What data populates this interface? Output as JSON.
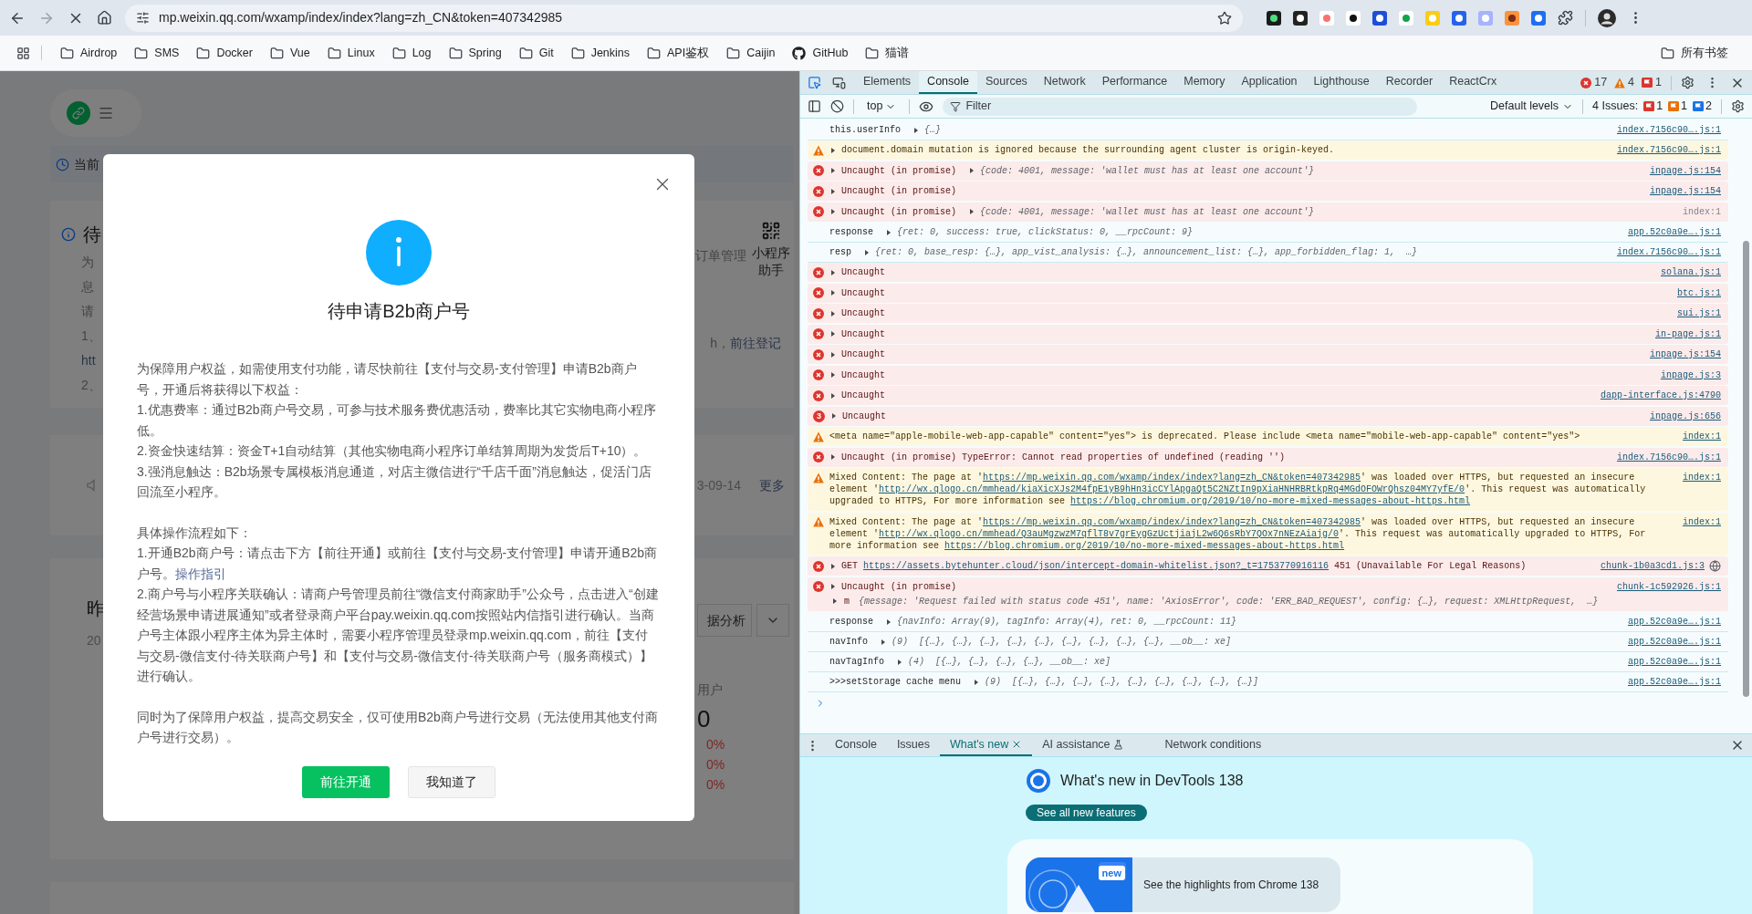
{
  "browser": {
    "url": "mp.weixin.qq.com/wxamp/index/index?lang=zh_CN&token=407342985",
    "bookmarks": [
      {
        "kind": "folder",
        "label": "Airdrop"
      },
      {
        "kind": "folder",
        "label": "SMS"
      },
      {
        "kind": "folder",
        "label": "Docker"
      },
      {
        "kind": "folder",
        "label": "Vue"
      },
      {
        "kind": "folder",
        "label": "Linux"
      },
      {
        "kind": "folder",
        "label": "Log"
      },
      {
        "kind": "folder",
        "label": "Spring"
      },
      {
        "kind": "folder",
        "label": "Git"
      },
      {
        "kind": "folder",
        "label": "Jenkins"
      },
      {
        "kind": "folder",
        "label": "API鉴权"
      },
      {
        "kind": "folder",
        "label": "Caijin"
      },
      {
        "kind": "site",
        "label": "GitHub"
      },
      {
        "kind": "folder",
        "label": "猫谱"
      }
    ],
    "all_bookmarks": "所有书签"
  },
  "page": {
    "banner": "当前",
    "notice": {
      "title": "待",
      "lines": [
        {
          "kind": "text",
          "text": "为"
        },
        {
          "kind": "text",
          "text": "息"
        },
        {
          "kind": "text",
          "text": "请"
        },
        {
          "kind": "text",
          "text": "1、"
        },
        {
          "kind": "link",
          "text": "htt"
        },
        {
          "kind": "text",
          "text": "2、"
        }
      ],
      "right_text": "订单管理",
      "helper": "小程序助手",
      "register_prefix": "h，",
      "register_link": "前往登记"
    },
    "announcement": {
      "date": "3-09-14",
      "more": "更多"
    },
    "stats": {
      "title": "昨",
      "date": "20",
      "analysis": "据分析",
      "metric": "用户",
      "value": "0",
      "changes": [
        "0%",
        "0%",
        "0%"
      ]
    }
  },
  "dialog": {
    "title": "待申请B2b商户号",
    "sections": [
      {
        "lines": [
          {
            "text": "为保障用户权益，如需使用支付功能，请尽快前往【支付与交易-支付管理】申请B2b商户号，开通后将获得以下权益："
          },
          {
            "text": "1.优惠费率：通过B2b商户号交易，可参与技术服务费优惠活动，费率比其它实物电商小程序低。"
          },
          {
            "text": "2.资金快速结算：资金T+1自动结算（其他实物电商小程序订单结算周期为发货后T+10）。"
          },
          {
            "text": "3.强消息触达：B2b场景专属模板消息通道，对店主微信进行“千店千面”消息触达，促活门店回流至小程序。"
          }
        ]
      },
      {
        "lines": [
          {
            "text": "具体操作流程如下："
          },
          {
            "text": "1.开通B2b商户号：请点击下方【前往开通】或前往【支付与交易-支付管理】申请开通B2b商户号。",
            "link": "操作指引"
          },
          {
            "text": "2.商户号与小程序关联确认：请商户号管理员前往“微信支付商家助手”公众号，点击进入“创建经营场景申请进展通知”或者登录商户平台pay.weixin.qq.com按照站内信指引进行确认。当商户号主体跟小程序主体为异主体时，需要小程序管理员登录mp.weixin.qq.com，前往【支付与交易-微信支付-待关联商户号】和【支付与交易-微信支付-待关联商户号（服务商模式）】进行确认。"
          }
        ]
      },
      {
        "lines": [
          {
            "text": "同时为了保障用户权益，提高交易安全，仅可使用B2b商户号进行交易（无法使用其他支付商户号进行交易）。"
          }
        ]
      }
    ],
    "buttons": [
      {
        "kind": "primary",
        "label": "前往开通"
      },
      {
        "kind": "secondary",
        "label": "我知道了"
      }
    ]
  },
  "devtools": {
    "tabs": [
      {
        "label": "Elements",
        "selected": false
      },
      {
        "label": "Console",
        "selected": true
      },
      {
        "label": "Sources",
        "selected": false
      },
      {
        "label": "Network",
        "selected": false
      },
      {
        "label": "Performance",
        "selected": false
      },
      {
        "label": "Memory",
        "selected": false
      },
      {
        "label": "Application",
        "selected": false
      },
      {
        "label": "Lighthouse",
        "selected": false
      },
      {
        "label": "Recorder",
        "selected": false
      },
      {
        "label": "ReactCrx",
        "selected": false
      }
    ],
    "counts": [
      {
        "kind": "error",
        "count": "17"
      },
      {
        "kind": "warning",
        "count": "4"
      },
      {
        "kind": "issue",
        "count": "1"
      }
    ],
    "toolbar": {
      "context": "top",
      "filter_placeholder": "Filter",
      "levels": "Default levels",
      "issues_label": "4 Issues:",
      "issue_counts": [
        {
          "kind": "error",
          "count": "1"
        },
        {
          "kind": "warning",
          "count": "1"
        },
        {
          "kind": "info",
          "count": "2"
        }
      ]
    },
    "console": [
      {
        "kind": "log",
        "expandable": false,
        "text": "this.userInfo",
        "preview": "{…}",
        "source": "index.7156c90….js:1",
        "source_link": true
      },
      {
        "kind": "warning",
        "expandable": true,
        "text": "document.domain mutation is ignored because the surrounding agent cluster is origin-keyed.",
        "source": "index.7156c90….js:1",
        "source_link": true
      },
      {
        "kind": "error",
        "expandable": true,
        "text": "Uncaught (in promise)",
        "preview": "{code: 4001, message: 'wallet must has at least one account'}",
        "source": "inpage.js:154",
        "source_link": true
      },
      {
        "kind": "error",
        "expandable": true,
        "text": "Uncaught (in promise)",
        "source": "inpage.js:154",
        "source_link": true
      },
      {
        "kind": "error",
        "expandable": true,
        "text": "Uncaught (in promise)",
        "preview": "{code: 4001, message: 'wallet must has at least one account'}",
        "source": "index:1",
        "source_link": false
      },
      {
        "kind": "log",
        "expandable": false,
        "text": "response",
        "preview": "{ret: 0, success: true, clickStatus: 0, __rpcCount: 9}",
        "source": "app.52c0a9e….js:1",
        "source_link": true
      },
      {
        "kind": "log",
        "expandable": false,
        "text": "resp",
        "preview": "{ret: 0, base_resp: {…}, app_vist_analysis: {…}, announcement_list: {…}, app_forbidden_flag: 1,  …}",
        "source": "index.7156c90….js:1",
        "source_link": true
      },
      {
        "kind": "error",
        "expandable": true,
        "text": "Uncaught",
        "source": "solana.js:1",
        "source_link": true
      },
      {
        "kind": "error",
        "expandable": true,
        "text": "Uncaught",
        "source": "btc.js:1",
        "source_link": true
      },
      {
        "kind": "error",
        "expandable": true,
        "text": "Uncaught",
        "source": "sui.js:1",
        "source_link": true
      },
      {
        "kind": "error",
        "expandable": true,
        "text": "Uncaught",
        "source": "in-page.js:1",
        "source_link": true
      },
      {
        "kind": "error",
        "expandable": true,
        "text": "Uncaught",
        "source": "inpage.js:154",
        "source_link": true
      },
      {
        "kind": "error",
        "expandable": true,
        "text": "Uncaught",
        "source": "inpage.js:3",
        "source_link": true
      },
      {
        "kind": "error",
        "expandable": true,
        "text": "Uncaught",
        "source": "dapp-interface.js:4790",
        "source_link": true
      },
      {
        "kind": "error",
        "expandable": true,
        "count": "3",
        "text": "Uncaught",
        "source": "inpage.js:656",
        "source_link": true
      },
      {
        "kind": "warning",
        "expandable": false,
        "text": "<meta name=\"apple-mobile-web-app-capable\" content=\"yes\"> is deprecated. Please include <meta name=\"mobile-web-app-capable\" content=\"yes\">",
        "source": "index:1",
        "source_link": true
      },
      {
        "kind": "error",
        "expandable": true,
        "text": "Uncaught (in promise) TypeError: Cannot read properties of undefined (reading '')",
        "source": "index.7156c90….js:1",
        "source_link": true
      },
      {
        "kind": "warning",
        "expandable": false,
        "segments": [
          {
            "kind": "text",
            "text": "Mixed Content: The page at '"
          },
          {
            "kind": "link",
            "text": "https://mp.weixin.qq.com/wxamp/index/index?lang=zh_CN&token=407342985"
          },
          {
            "kind": "text",
            "text": "' was loaded over HTTPS, but requested an insecure element '"
          },
          {
            "kind": "link",
            "text": "http://wx.qlogo.cn/mmhead/kiaXicXJs2M4fpE1yB9hHn3icCYlApgaQt5C2NZtIn9pXiaHNHRBRtkpRq4MGdOFOWrQhsz04MY7yfE/0"
          },
          {
            "kind": "text",
            "text": "'. This request was automatically upgraded to HTTPS, For more information see "
          },
          {
            "kind": "link",
            "text": "https://blog.chromium.org/2019/10/no-more-mixed-messages-about-https.html"
          }
        ],
        "source": "index:1",
        "source_link": true
      },
      {
        "kind": "warning",
        "expandable": false,
        "segments": [
          {
            "kind": "text",
            "text": "Mixed Content: The page at '"
          },
          {
            "kind": "link",
            "text": "https://mp.weixin.qq.com/wxamp/index/index?lang=zh_CN&token=407342985"
          },
          {
            "kind": "text",
            "text": "' was loaded over HTTPS, but requested an insecure element '"
          },
          {
            "kind": "link",
            "text": "http://wx.qlogo.cn/mmhead/Q3auMgzwzM7qflT8v7grEygGzUctjiajL2w6Q6sRbY7QOx7nNEzAiajg/0"
          },
          {
            "kind": "text",
            "text": "'. This request was automatically upgraded to HTTPS, For more information see "
          },
          {
            "kind": "link",
            "text": "https://blog.chromium.org/2019/10/no-more-mixed-messages-about-https.html"
          }
        ],
        "source": "index:1",
        "source_link": true
      },
      {
        "kind": "error",
        "expandable": true,
        "segments": [
          {
            "kind": "text",
            "text": "GET "
          },
          {
            "kind": "link",
            "text": "https://assets.bytehunter.cloud/json/intercept-domain-whitelist.json?_t=1753770916116"
          },
          {
            "kind": "text",
            "text": " 451 (Unavailable For Legal Reasons)"
          }
        ],
        "source": "chunk-1b0a3cd1.js:3",
        "source_link": true,
        "network": true
      },
      {
        "kind": "error",
        "expandable": true,
        "text": "Uncaught (in promise)",
        "detail": {
          "label": "m",
          "preview": "{message: 'Request failed with status code 451', name: 'AxiosError', code: 'ERR_BAD_REQUEST', config: {…}, request: XMLHttpRequest,  …}"
        },
        "source": "chunk-1c592926.js:1",
        "source_link": true
      },
      {
        "kind": "log",
        "expandable": false,
        "text": "response",
        "preview": "{navInfo: Array(9), tagInfo: Array(4), ret: 0, __rpcCount: 11}",
        "source": "app.52c0a9e….js:1",
        "source_link": true
      },
      {
        "kind": "log",
        "expandable": false,
        "text": "navInfo",
        "preview": "(9)  [{…}, {…}, {…}, {…}, {…}, {…}, {…}, {…}, {…}, __ob__: xe]",
        "source": "app.52c0a9e….js:1",
        "source_link": true
      },
      {
        "kind": "log",
        "expandable": false,
        "text": "navTagInfo",
        "preview": "(4)  [{…}, {…}, {…}, {…}, __ob__: xe]",
        "source": "app.52c0a9e….js:1",
        "source_link": true
      },
      {
        "kind": "log",
        "expandable": false,
        "text": ">>>setStorage cache menu",
        "preview": "(9)  [{…}, {…}, {…}, {…}, {…}, {…}, {…}, {…}, {…}]",
        "source": "app.52c0a9e….js:1",
        "source_link": true
      }
    ],
    "drawer": {
      "tabs": [
        {
          "label": "Console",
          "kind": "plain",
          "selected": false
        },
        {
          "label": "Issues",
          "kind": "plain",
          "selected": false
        },
        {
          "label": "What's new",
          "kind": "closable",
          "selected": true
        },
        {
          "label": "AI assistance",
          "kind": "experimental",
          "selected": false
        },
        {
          "label": "Network conditions",
          "kind": "plain",
          "selected": false
        }
      ],
      "heading": "What's new in DevTools 138",
      "button": "See all new features",
      "card_badge": "new",
      "card_text": "See the highlights from Chrome 138"
    }
  }
}
